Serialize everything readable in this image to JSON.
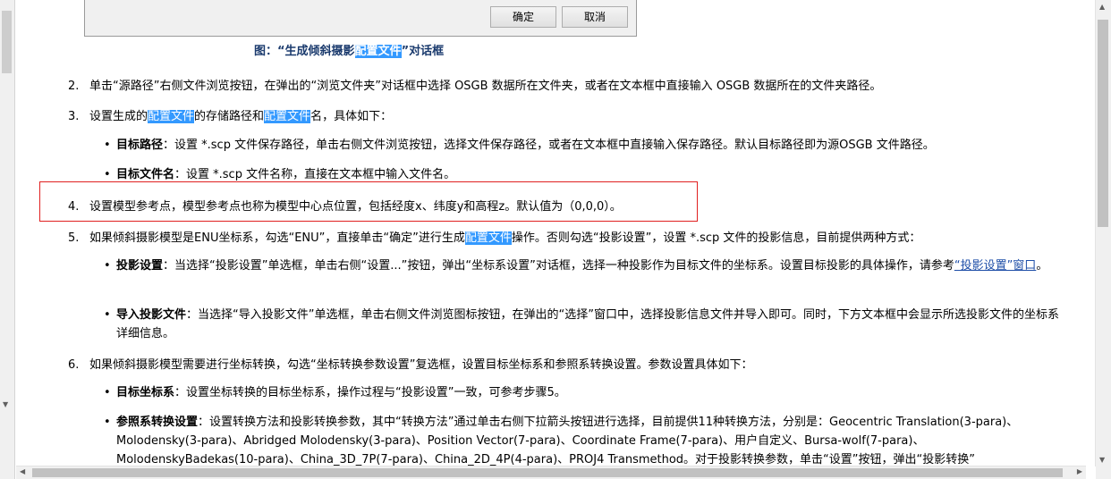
{
  "dialog": {
    "ok_label": "确定",
    "cancel_label": "取消"
  },
  "caption": {
    "prefix": "图：“生成倾斜摄影",
    "highlight": "配置文件",
    "suffix": "”对话框"
  },
  "steps": [
    {
      "num": "2.",
      "text": "单击“源路径”右侧文件浏览按钮，在弹出的“浏览文件夹”对话框中选择 OSGB 数据所在文件夹，或者在文本框中直接输入 OSGB 数据所在的文件夹路径。"
    },
    {
      "num": "3.",
      "parts": [
        "设置生成的",
        "配置文件",
        "的存储路径和",
        "配置文件",
        "名，具体如下："
      ]
    },
    {
      "num": "4.",
      "text": "设置模型参考点，模型参考点也称为模型中心点位置，包括经度x、纬度y和高程z。默认值为（0,0,0）。"
    },
    {
      "num": "5.",
      "parts": [
        "如果倾斜摄影模型是ENU坐标系，勾选“ENU”，直接单击“确定”进行生成",
        "配置文件",
        "操作。否则勾选“投影设置”，设置 *.scp 文件的投影信息，目前提供两种方式："
      ]
    },
    {
      "num": "6.",
      "text": "如果倾斜摄影模型需要进行坐标转换，勾选“坐标转换参数设置”复选框，设置目标坐标系和参照系转换设置。参数设置具体如下："
    }
  ],
  "bullets": {
    "target_path": {
      "label": "目标路径",
      "text": "：设置 *.scp 文件保存路径，单击右侧文件浏览按钮，选择文件保存路径，或者在文本框中直接输入保存路径。默认目标路径即为源OSGB 文件路径。"
    },
    "target_name": {
      "label": "目标文件名",
      "text": "：设置 *.scp 文件名称，直接在文本框中输入文件名。"
    },
    "proj_setting": {
      "label": "投影设置",
      "text": "：当选择“投影设置”单选框，单击右侧“设置...”按钮，弹出“坐标系设置”对话框，选择一种投影作为目标文件的坐标系。设置目标投影的具体操作，请参考",
      "link": "“投影设置”窗口",
      "end": "。"
    },
    "import_proj": {
      "label": "导入投影文件",
      "text": "：当选择“导入投影文件”单选框，单击右侧文件浏览图标按钮，在弹出的“选择”窗口中，选择投影信息文件并导入即可。同时，下方文本框中会显示所选投影文件的坐标系详细信息。"
    },
    "target_cs": {
      "label": "目标坐标系",
      "text": "：设置坐标转换的目标坐标系，操作过程与“投影设置”一致，可参考步骤5。"
    },
    "ref_transform": {
      "label": "参照系转换设置",
      "text": "：设置转换方法和投影转换参数，其中“转换方法”通过单击右侧下拉箭头按钮进行选择，目前提供11种转换方法，分别是：Geocentric Translation(3-para)、Molodensky(3-para)、Abridged Molodensky(3-para)、Position Vector(7-para)、Coordinate Frame(7-para)、用户自定义、Bursa-wolf(7-para)、MolodenskyBadekas(10-para)、China_3D_7P(7-para)、China_2D_4P(4-para)、PROJ4 Transmethod。对于投影转换参数，单击“设置”按钮，弹出“投影转换”"
    }
  },
  "icons": {
    "bullet": "•",
    "up": "▲",
    "down": "▼",
    "left": "◀",
    "right": "▶"
  },
  "colors": {
    "highlight": "#3399ff",
    "redbox": "#e02020",
    "caption": "#1a3a6d",
    "link": "#1f4fa8"
  }
}
